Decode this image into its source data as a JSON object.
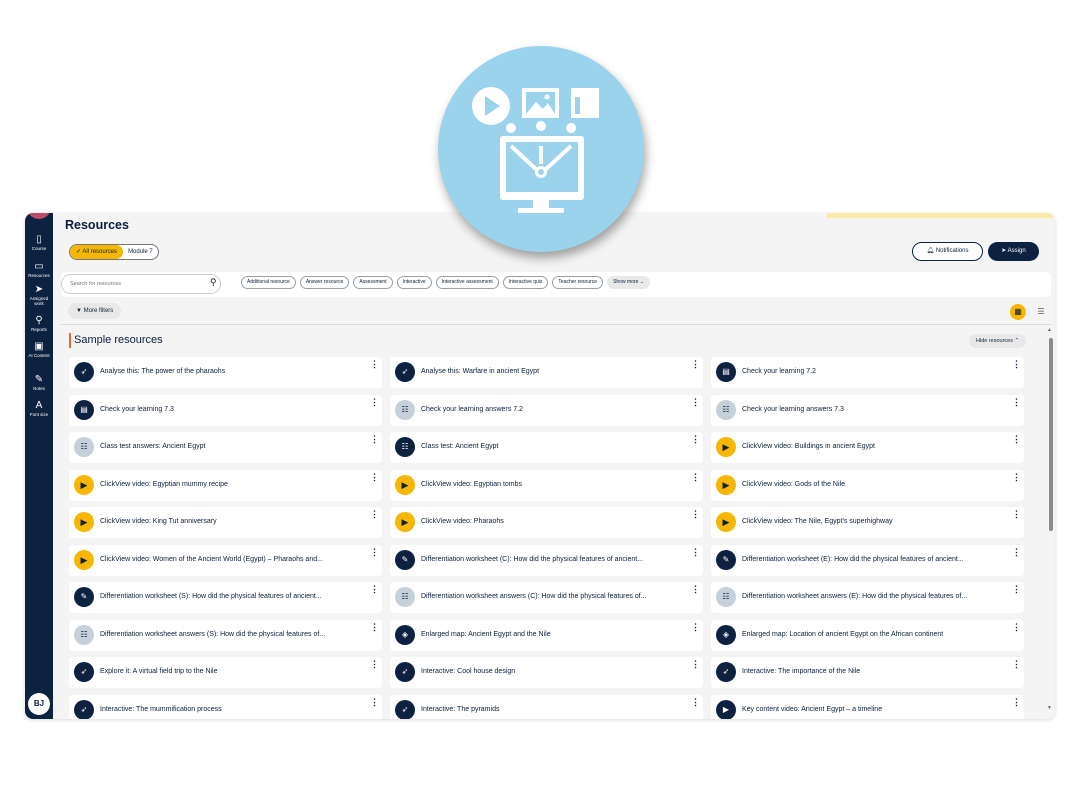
{
  "colors": {
    "hero_circle": "#9bd3ec",
    "sidebar": "#0d2140",
    "accent_yellow": "#f7b700",
    "section_accent": "#e56a2c",
    "card_background": "#ffffff",
    "app_background": "#f4f4f4"
  },
  "hero": {
    "icon": "interactive-resources-monitor-icon"
  },
  "sidebar": {
    "items": [
      {
        "label": "Course",
        "icon": "book-icon"
      },
      {
        "label": "Resources",
        "icon": "folder-icon"
      },
      {
        "label": "Assigned work",
        "icon": "send-icon"
      },
      {
        "label": "Reports",
        "icon": "reports-icon"
      },
      {
        "label": "AI Content",
        "icon": "ai-content-icon"
      },
      {
        "label": "Notes",
        "icon": "pencil-icon"
      },
      {
        "label": "Font size",
        "icon": "font-size-icon"
      }
    ],
    "avatar": "BJ"
  },
  "header": {
    "title": "Resources",
    "toggle": {
      "active": "All resources",
      "inactive": "Module 7"
    },
    "notifications_label": "Notifications",
    "assign_label": "Assign"
  },
  "search": {
    "placeholder": "Search for resources"
  },
  "chips": [
    "Additional resource",
    "Answer resource",
    "Assessment",
    "Interactive",
    "Interactive assessment",
    "Interactive quiz",
    "Teacher resource"
  ],
  "show_more_label": "Show more",
  "more_filters_label": "More filters",
  "section": {
    "title": "Sample resources",
    "hide_label": "Hide resources"
  },
  "resources": [
    {
      "title": "Analyse this: The power of the pharaohs",
      "icon": "cursor-click-icon",
      "style": "dark"
    },
    {
      "title": "Analyse this: Warfare in ancient Egypt",
      "icon": "cursor-click-icon",
      "style": "dark"
    },
    {
      "title": "Check your learning 7.2",
      "icon": "screen-chart-icon",
      "style": "dark"
    },
    {
      "title": "Check your learning 7.3",
      "icon": "screen-chart-icon",
      "style": "dark"
    },
    {
      "title": "Check your learning answers 7.2",
      "icon": "answer-sheet-icon",
      "style": "light"
    },
    {
      "title": "Check your learning answers 7.3",
      "icon": "answer-sheet-icon",
      "style": "light"
    },
    {
      "title": "Class test answers: Ancient Egypt",
      "icon": "answer-sheet-icon",
      "style": "light"
    },
    {
      "title": "Class test: Ancient Egypt",
      "icon": "test-sheet-icon",
      "style": "dark"
    },
    {
      "title": "ClickView video: Buildings in ancient Egypt",
      "icon": "play-icon",
      "style": "play"
    },
    {
      "title": "ClickView video: Egyptian mummy recipe",
      "icon": "play-icon",
      "style": "play"
    },
    {
      "title": "ClickView video: Egyptian tombs",
      "icon": "play-icon",
      "style": "play"
    },
    {
      "title": "ClickView video: Gods of the Nile",
      "icon": "play-icon",
      "style": "play"
    },
    {
      "title": "ClickView video: King Tut anniversary",
      "icon": "play-icon",
      "style": "play"
    },
    {
      "title": "ClickView video: Pharaohs",
      "icon": "play-icon",
      "style": "play"
    },
    {
      "title": "ClickView video: The Nile, Egypt's superhighway",
      "icon": "play-icon",
      "style": "play"
    },
    {
      "title": "ClickView video: Women of the Ancient World (Egypt) – Pharaohs and...",
      "icon": "play-icon",
      "style": "play"
    },
    {
      "title": "Differentiation worksheet (C): How did the physical features of ancient...",
      "icon": "worksheet-edit-icon",
      "style": "dark"
    },
    {
      "title": "Differentiation worksheet (E): How did the physical features of ancient...",
      "icon": "worksheet-edit-icon",
      "style": "dark"
    },
    {
      "title": "Differentiation worksheet (S): How did the physical features of ancient...",
      "icon": "worksheet-edit-icon",
      "style": "dark"
    },
    {
      "title": "Differentiation worksheet answers (C): How did the physical features of...",
      "icon": "answer-sheet-icon",
      "style": "light"
    },
    {
      "title": "Differentiation worksheet answers (E): How did the physical features of...",
      "icon": "answer-sheet-icon",
      "style": "light"
    },
    {
      "title": "Differentiation worksheet answers (S): How did the physical features of...",
      "icon": "answer-sheet-icon",
      "style": "light"
    },
    {
      "title": "Enlarged map: Ancient Egypt and the Nile",
      "icon": "map-sheet-icon",
      "style": "dark"
    },
    {
      "title": "Enlarged map: Location of ancient Egypt on the African continent",
      "icon": "map-sheet-icon",
      "style": "dark"
    },
    {
      "title": "Explore it: A virtual field trip to the Nile",
      "icon": "cursor-click-icon",
      "style": "dark"
    },
    {
      "title": "Interactive: Cool house design",
      "icon": "cursor-click-icon",
      "style": "dark"
    },
    {
      "title": "Interactive: The importance of the Nile",
      "icon": "cursor-click-icon",
      "style": "dark"
    },
    {
      "title": "Interactive: The mummification process",
      "icon": "cursor-click-icon",
      "style": "dark"
    },
    {
      "title": "Interactive: The pyramids",
      "icon": "cursor-click-icon",
      "style": "dark"
    },
    {
      "title": "Key content video: Ancient Egypt – a timeline",
      "icon": "play-icon",
      "style": "dark"
    }
  ]
}
